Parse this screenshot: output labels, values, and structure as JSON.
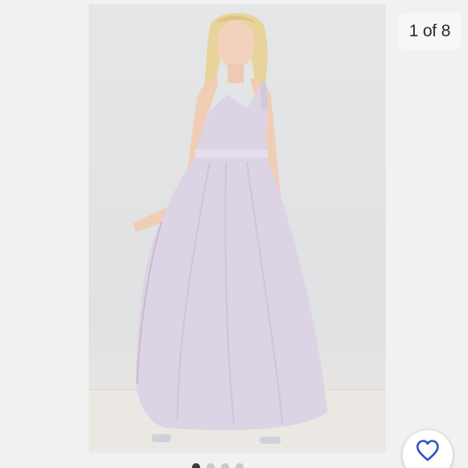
{
  "gallery": {
    "counter_text": "1 of 8",
    "current_index": 1,
    "total_images": 8,
    "dress_color": "#dcd3e4",
    "accent_color": "#2f54c7",
    "background_color": "#f1f1f1"
  },
  "icons": {
    "like": "heart-outline-icon"
  }
}
